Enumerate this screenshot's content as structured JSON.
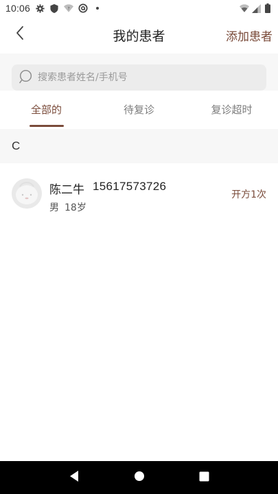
{
  "status_bar": {
    "time": "10:06",
    "left_icons": [
      "gear-icon",
      "shield-icon",
      "wifi-question-icon",
      "at-sign-icon",
      "dot-icon"
    ],
    "right_icons": [
      "wifi-icon",
      "signal-icon",
      "battery-icon"
    ]
  },
  "header": {
    "title": "我的患者",
    "add_label": "添加患者",
    "back_icon": "chevron-left-icon"
  },
  "search": {
    "placeholder": "搜索患者姓名/手机号",
    "value": "",
    "icon": "search-icon"
  },
  "tabs": [
    {
      "label": "全部的",
      "active": true
    },
    {
      "label": "待复诊",
      "active": false
    },
    {
      "label": "复诊超时",
      "active": false
    }
  ],
  "groups": [
    {
      "letter": "C",
      "patients": [
        {
          "name": "陈二牛",
          "phone": "15617573726",
          "gender": "男",
          "age": "18岁",
          "prescriptions": "开方1次",
          "avatar_icon": "avatar-placeholder-icon"
        }
      ]
    }
  ],
  "nav_bar": {
    "buttons": [
      "back-triangle-icon",
      "home-circle-icon",
      "recents-square-icon"
    ]
  },
  "colors": {
    "accent": "#7a4b3a",
    "background": "#ffffff",
    "section_bg": "#f7f7f7",
    "search_bg": "#ececec"
  }
}
